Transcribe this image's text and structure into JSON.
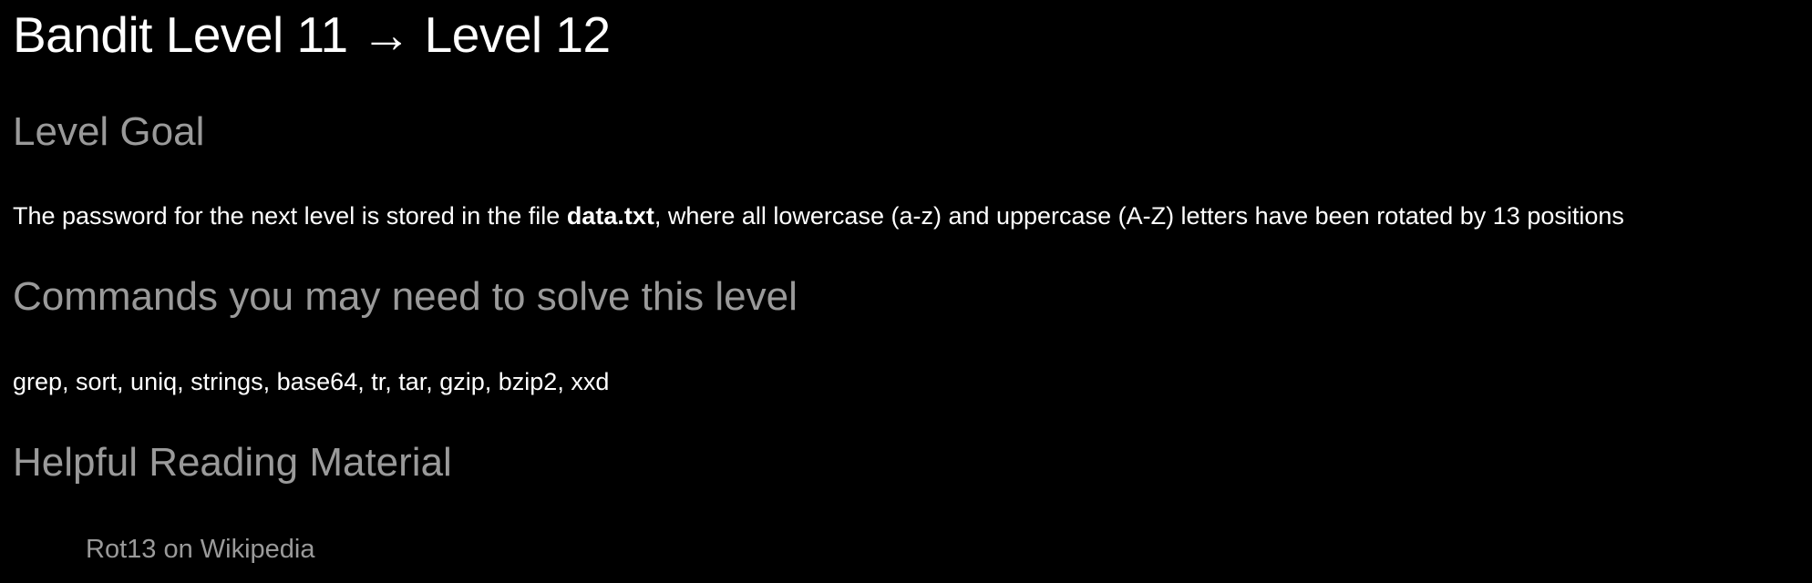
{
  "title": "Bandit Level 11 → Level 12",
  "goal": {
    "heading": "Level Goal",
    "text_before": "The password for the next level is stored in the file ",
    "filename": "data.txt",
    "text_after": ", where all lowercase (a-z) and uppercase (A-Z) letters have been rotated by 13 positions"
  },
  "commands": {
    "heading": "Commands you may need to solve this level",
    "list": "grep, sort, uniq, strings, base64, tr, tar, gzip, bzip2, xxd"
  },
  "reading": {
    "heading": "Helpful Reading Material",
    "links": [
      {
        "label": "Rot13 on Wikipedia"
      }
    ]
  }
}
